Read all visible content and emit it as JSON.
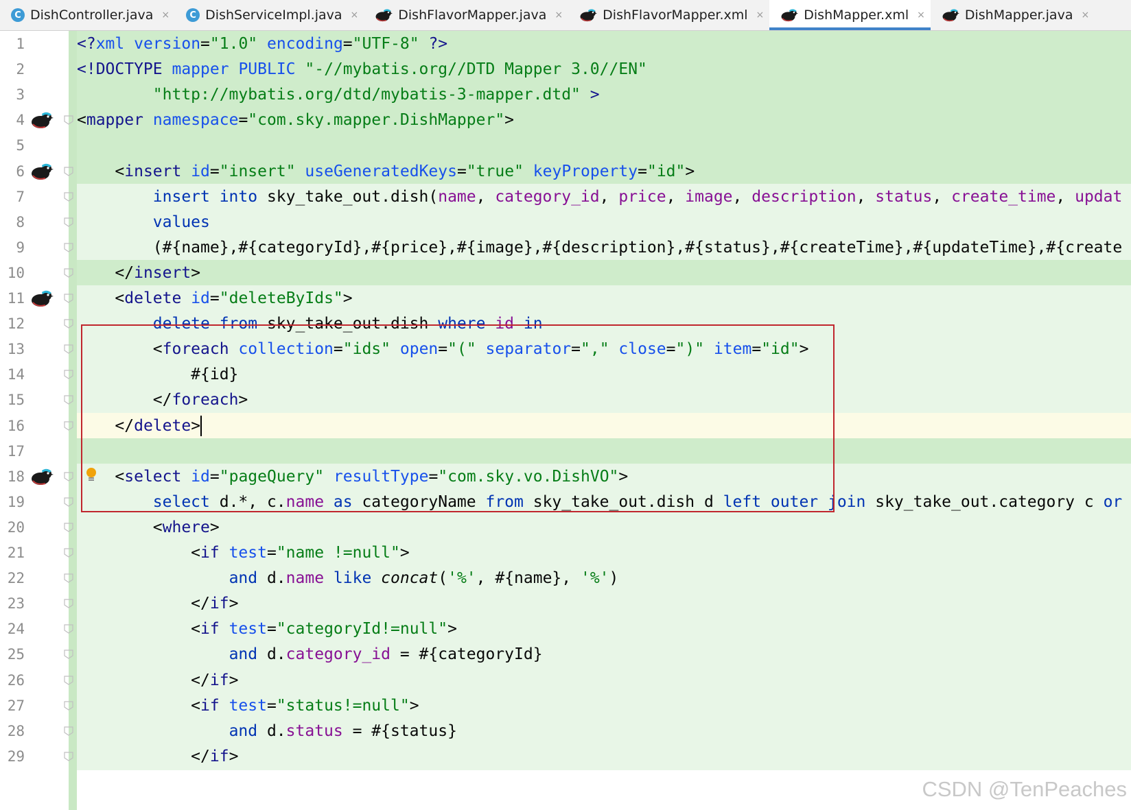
{
  "tabs": [
    {
      "label": "DishController.java",
      "icon": "java-class-icon",
      "active": false
    },
    {
      "label": "DishServiceImpl.java",
      "icon": "java-class-icon",
      "active": false
    },
    {
      "label": "DishFlavorMapper.java",
      "icon": "mybatis-bird-icon",
      "active": false
    },
    {
      "label": "DishFlavorMapper.xml",
      "icon": "mybatis-bird-icon",
      "active": false
    },
    {
      "label": "DishMapper.xml",
      "icon": "mybatis-bird-icon",
      "active": true
    },
    {
      "label": "DishMapper.java",
      "icon": "mybatis-bird-icon",
      "active": false
    }
  ],
  "tab_close_glyph": "×",
  "colors": {
    "added_line_bg": "#cfeccb",
    "block_bg": "#e8f6e7",
    "tag_highlight": "#b9e3ff",
    "current_line": "#fcfbe6",
    "red_box": "#c0262d"
  },
  "lines": [
    {
      "n": "1",
      "tokens": [
        [
          "t-tag",
          "<?"
        ],
        [
          "t-attr",
          "xml"
        ],
        [
          "t-plain",
          " "
        ],
        [
          "t-attr",
          "version"
        ],
        [
          "t-plain",
          "="
        ],
        [
          "t-str",
          "\"1.0\""
        ],
        [
          "t-plain",
          " "
        ],
        [
          "t-attr",
          "encoding"
        ],
        [
          "t-plain",
          "="
        ],
        [
          "t-str",
          "\"UTF-8\""
        ],
        [
          "t-plain",
          " "
        ],
        [
          "t-tag",
          "?>"
        ]
      ]
    },
    {
      "n": "2",
      "tokens": [
        [
          "t-tag",
          "<!DOCTYPE "
        ],
        [
          "t-attr",
          "mapper"
        ],
        [
          "t-plain",
          " "
        ],
        [
          "t-attr",
          "PUBLIC"
        ],
        [
          "t-plain",
          " "
        ],
        [
          "t-str",
          "\"-//mybatis.org//DTD Mapper 3.0//EN\""
        ]
      ]
    },
    {
      "n": "3",
      "tokens": [
        [
          "t-plain",
          "        "
        ],
        [
          "t-str",
          "\"http://mybatis.org/dtd/mybatis-3-mapper.dtd\""
        ],
        [
          "t-plain",
          " "
        ],
        [
          "t-tag",
          ">"
        ]
      ]
    },
    {
      "n": "4",
      "tokens": [
        [
          "t-plain",
          "<"
        ],
        [
          "t-tag",
          "mapper"
        ],
        [
          "t-plain",
          " "
        ],
        [
          "t-attr",
          "namespace"
        ],
        [
          "t-plain",
          "="
        ],
        [
          "t-str",
          "\"com.sky.mapper.DishMapper\""
        ],
        [
          "t-plain",
          ">"
        ]
      ]
    },
    {
      "n": "5",
      "tokens": []
    },
    {
      "n": "6",
      "tokens": [
        [
          "t-plain",
          "    <"
        ],
        [
          "t-tag",
          "insert"
        ],
        [
          "t-plain",
          " "
        ],
        [
          "t-attr",
          "id"
        ],
        [
          "t-plain",
          "="
        ],
        [
          "t-str",
          "\"insert\""
        ],
        [
          "t-plain",
          " "
        ],
        [
          "t-attr",
          "useGeneratedKeys"
        ],
        [
          "t-plain",
          "="
        ],
        [
          "t-str",
          "\"true\""
        ],
        [
          "t-plain",
          " "
        ],
        [
          "t-attr",
          "keyProperty"
        ],
        [
          "t-plain",
          "="
        ],
        [
          "t-str",
          "\"id\""
        ],
        [
          "t-plain",
          ">"
        ]
      ]
    },
    {
      "n": "7",
      "tokens": [
        [
          "t-plain",
          "        "
        ],
        [
          "t-kw",
          "insert into"
        ],
        [
          "t-plain",
          " sky_take_out.dish("
        ],
        [
          "t-field",
          "name"
        ],
        [
          "t-plain",
          ", "
        ],
        [
          "t-field",
          "category_id"
        ],
        [
          "t-plain",
          ", "
        ],
        [
          "t-field",
          "price"
        ],
        [
          "t-plain",
          ", "
        ],
        [
          "t-field",
          "image"
        ],
        [
          "t-plain",
          ", "
        ],
        [
          "t-field",
          "description"
        ],
        [
          "t-plain",
          ", "
        ],
        [
          "t-field",
          "status"
        ],
        [
          "t-plain",
          ", "
        ],
        [
          "t-field",
          "create_time"
        ],
        [
          "t-plain",
          ", "
        ],
        [
          "t-field",
          "updat"
        ]
      ]
    },
    {
      "n": "8",
      "tokens": [
        [
          "t-plain",
          "        "
        ],
        [
          "t-kw",
          "values"
        ]
      ]
    },
    {
      "n": "9",
      "tokens": [
        [
          "t-plain",
          "        (#{name},#{categoryId},#{price},#{image},#{description},#{status},#{createTime},#{updateTime},#{create"
        ]
      ]
    },
    {
      "n": "10",
      "tokens": [
        [
          "t-plain",
          "    </"
        ],
        [
          "t-tag",
          "insert"
        ],
        [
          "t-plain",
          ">"
        ]
      ]
    },
    {
      "n": "11",
      "tokens": [
        [
          "t-plain",
          "    <"
        ],
        [
          "t-tag",
          "delete"
        ],
        [
          "t-plain",
          " "
        ],
        [
          "t-attr",
          "id"
        ],
        [
          "t-plain",
          "="
        ],
        [
          "t-str",
          "\"deleteByIds\""
        ],
        [
          "t-plain",
          ">"
        ]
      ]
    },
    {
      "n": "12",
      "tokens": [
        [
          "t-plain",
          "        "
        ],
        [
          "t-kw",
          "delete from"
        ],
        [
          "t-plain",
          " sky_take_out.dish "
        ],
        [
          "t-kw",
          "where"
        ],
        [
          "t-plain",
          " "
        ],
        [
          "t-field",
          "id"
        ],
        [
          "t-plain",
          " "
        ],
        [
          "t-kw",
          "in"
        ]
      ]
    },
    {
      "n": "13",
      "tokens": [
        [
          "t-plain",
          "        <"
        ],
        [
          "t-tag",
          "foreach"
        ],
        [
          "t-plain",
          " "
        ],
        [
          "t-attr",
          "collection"
        ],
        [
          "t-plain",
          "="
        ],
        [
          "t-str",
          "\"ids\""
        ],
        [
          "t-plain",
          " "
        ],
        [
          "t-attr",
          "open"
        ],
        [
          "t-plain",
          "="
        ],
        [
          "t-str",
          "\"(\""
        ],
        [
          "t-plain",
          " "
        ],
        [
          "t-attr",
          "separator"
        ],
        [
          "t-plain",
          "="
        ],
        [
          "t-str",
          "\",\""
        ],
        [
          "t-plain",
          " "
        ],
        [
          "t-attr",
          "close"
        ],
        [
          "t-plain",
          "="
        ],
        [
          "t-str",
          "\")\""
        ],
        [
          "t-plain",
          " "
        ],
        [
          "t-attr",
          "item"
        ],
        [
          "t-plain",
          "="
        ],
        [
          "t-str",
          "\"id\""
        ],
        [
          "t-plain",
          ">"
        ]
      ]
    },
    {
      "n": "14",
      "tokens": [
        [
          "t-plain",
          "            #{id}"
        ]
      ]
    },
    {
      "n": "15",
      "tokens": [
        [
          "t-plain",
          "        </"
        ],
        [
          "t-tag",
          "foreach"
        ],
        [
          "t-plain",
          ">"
        ]
      ]
    },
    {
      "n": "16",
      "tokens": [
        [
          "t-plain",
          "    </"
        ],
        [
          "t-tag",
          "delete"
        ],
        [
          "t-plain",
          ">"
        ]
      ]
    },
    {
      "n": "17",
      "tokens": []
    },
    {
      "n": "18",
      "tokens": [
        [
          "t-plain",
          "    <"
        ],
        [
          "t-tag",
          "select"
        ],
        [
          "t-plain",
          " "
        ],
        [
          "t-attr",
          "id"
        ],
        [
          "t-plain",
          "="
        ],
        [
          "t-str",
          "\"pageQuery\""
        ],
        [
          "t-plain",
          " "
        ],
        [
          "t-attr",
          "resultType"
        ],
        [
          "t-plain",
          "="
        ],
        [
          "t-str",
          "\"com.sky.vo.DishVO\""
        ],
        [
          "t-plain",
          ">"
        ]
      ]
    },
    {
      "n": "19",
      "tokens": [
        [
          "t-plain",
          "        "
        ],
        [
          "t-kw",
          "select"
        ],
        [
          "t-plain",
          " d.*, c."
        ],
        [
          "t-field",
          "name"
        ],
        [
          "t-plain",
          " "
        ],
        [
          "t-kw",
          "as"
        ],
        [
          "t-plain",
          " categoryName "
        ],
        [
          "t-kw",
          "from"
        ],
        [
          "t-plain",
          " sky_take_out.dish d "
        ],
        [
          "t-kw",
          "left outer join"
        ],
        [
          "t-plain",
          " sky_take_out.category c "
        ],
        [
          "t-kw",
          "or"
        ]
      ]
    },
    {
      "n": "20",
      "tokens": [
        [
          "t-plain",
          "        <"
        ],
        [
          "t-tag",
          "where"
        ],
        [
          "t-plain",
          ">"
        ]
      ]
    },
    {
      "n": "21",
      "tokens": [
        [
          "t-plain",
          "            <"
        ],
        [
          "t-tag",
          "if"
        ],
        [
          "t-plain",
          " "
        ],
        [
          "t-attr",
          "test"
        ],
        [
          "t-plain",
          "="
        ],
        [
          "t-str",
          "\"name !=null\""
        ],
        [
          "t-plain",
          ">"
        ]
      ]
    },
    {
      "n": "22",
      "tokens": [
        [
          "t-plain",
          "                "
        ],
        [
          "t-kw",
          "and"
        ],
        [
          "t-plain",
          " d."
        ],
        [
          "t-field",
          "name"
        ],
        [
          "t-plain",
          " "
        ],
        [
          "t-kw",
          "like"
        ],
        [
          "t-plain",
          " "
        ],
        [
          "t-it",
          "concat"
        ],
        [
          "t-plain",
          "("
        ],
        [
          "t-str",
          "'%'"
        ],
        [
          "t-plain",
          ", #{name}, "
        ],
        [
          "t-str",
          "'%'"
        ],
        [
          "t-plain",
          ")"
        ]
      ]
    },
    {
      "n": "23",
      "tokens": [
        [
          "t-plain",
          "            </"
        ],
        [
          "t-tag",
          "if"
        ],
        [
          "t-plain",
          ">"
        ]
      ]
    },
    {
      "n": "24",
      "tokens": [
        [
          "t-plain",
          "            <"
        ],
        [
          "t-tag",
          "if"
        ],
        [
          "t-plain",
          " "
        ],
        [
          "t-attr",
          "test"
        ],
        [
          "t-plain",
          "="
        ],
        [
          "t-str",
          "\"categoryId!=null\""
        ],
        [
          "t-plain",
          ">"
        ]
      ]
    },
    {
      "n": "25",
      "tokens": [
        [
          "t-plain",
          "                "
        ],
        [
          "t-kw",
          "and"
        ],
        [
          "t-plain",
          " d."
        ],
        [
          "t-field",
          "category_id"
        ],
        [
          "t-plain",
          " = #{categoryId}"
        ]
      ]
    },
    {
      "n": "26",
      "tokens": [
        [
          "t-plain",
          "            </"
        ],
        [
          "t-tag",
          "if"
        ],
        [
          "t-plain",
          ">"
        ]
      ]
    },
    {
      "n": "27",
      "tokens": [
        [
          "t-plain",
          "            <"
        ],
        [
          "t-tag",
          "if"
        ],
        [
          "t-plain",
          " "
        ],
        [
          "t-attr",
          "test"
        ],
        [
          "t-plain",
          "="
        ],
        [
          "t-str",
          "\"status!=null\""
        ],
        [
          "t-plain",
          ">"
        ]
      ]
    },
    {
      "n": "28",
      "tokens": [
        [
          "t-plain",
          "                "
        ],
        [
          "t-kw",
          "and"
        ],
        [
          "t-plain",
          " d."
        ],
        [
          "t-field",
          "status"
        ],
        [
          "t-plain",
          " = #{status}"
        ]
      ]
    },
    {
      "n": "29",
      "tokens": [
        [
          "t-plain",
          "            </"
        ],
        [
          "t-tag",
          "if"
        ],
        [
          "t-plain",
          ">"
        ]
      ]
    }
  ],
  "gutter_mybatis_lines": [
    "4",
    "6",
    "11",
    "18"
  ],
  "current_line": "16",
  "watermark": "CSDN @TenPeaches"
}
